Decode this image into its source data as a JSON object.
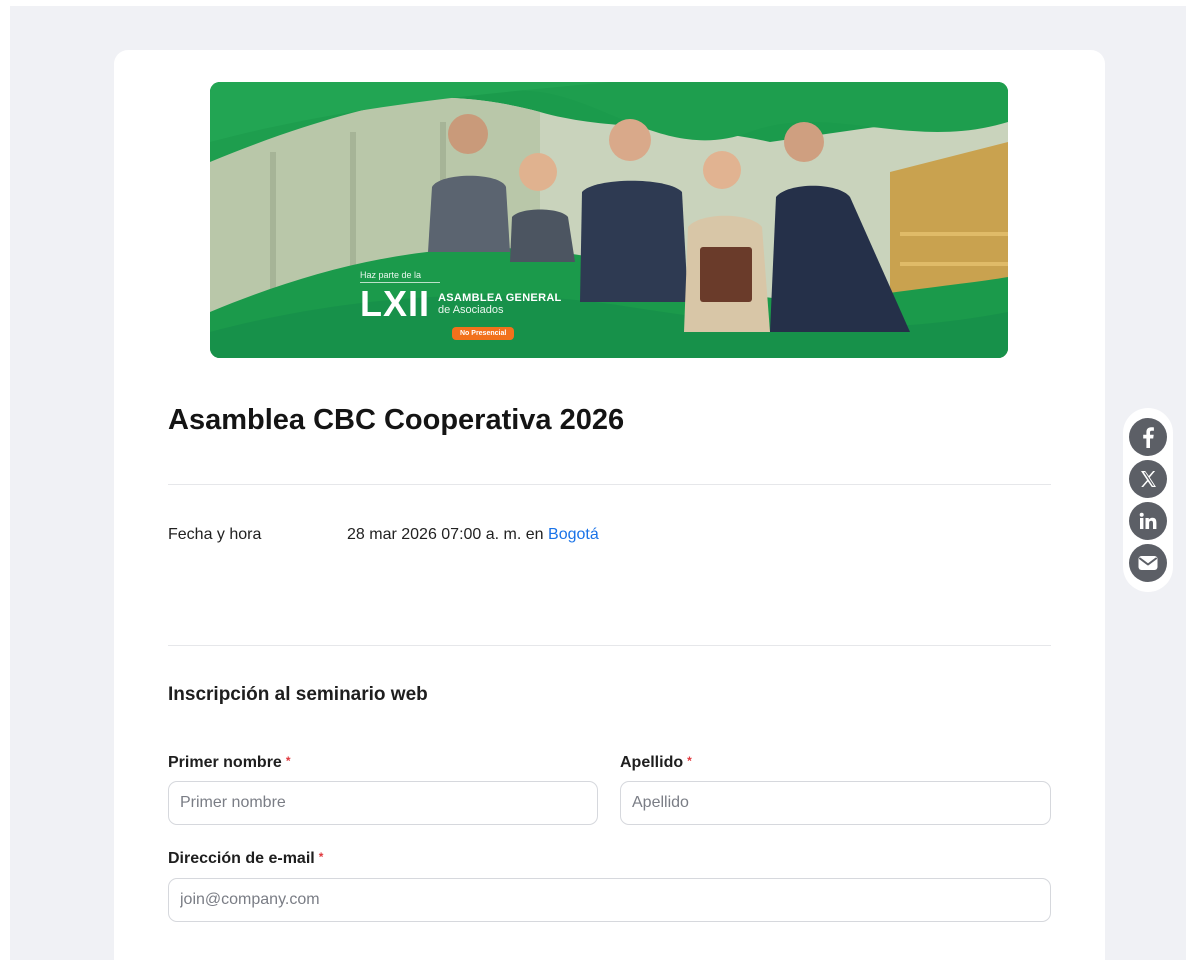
{
  "banner": {
    "tagline": "Haz parte de la",
    "roman": "LXII",
    "headline": "ASAMBLEA GENERAL",
    "subheadline": "de Asociados",
    "pill": "No Presencial"
  },
  "event": {
    "title": "Asamblea CBC Cooperativa 2026",
    "date_label": "Fecha y hora",
    "date_value": "28 mar 2026 07:00 a. m. en",
    "location_link": "Bogotá"
  },
  "registration": {
    "section_title": "Inscripción al seminario web",
    "first_name": {
      "label": "Primer nombre",
      "placeholder": "Primer nombre",
      "required_mark": "*"
    },
    "last_name": {
      "label": "Apellido",
      "placeholder": "Apellido",
      "required_mark": "*"
    },
    "email": {
      "label": "Dirección de e-mail",
      "placeholder": "join@company.com",
      "required_mark": "*"
    }
  },
  "social": {
    "icons": [
      "facebook-icon",
      "x-icon",
      "linkedin-icon",
      "email-icon"
    ]
  },
  "colors": {
    "brand_green": "#1a9a4a",
    "link_blue": "#1a73e8",
    "required_red": "#e0393e",
    "pill_orange": "#f2711c"
  }
}
